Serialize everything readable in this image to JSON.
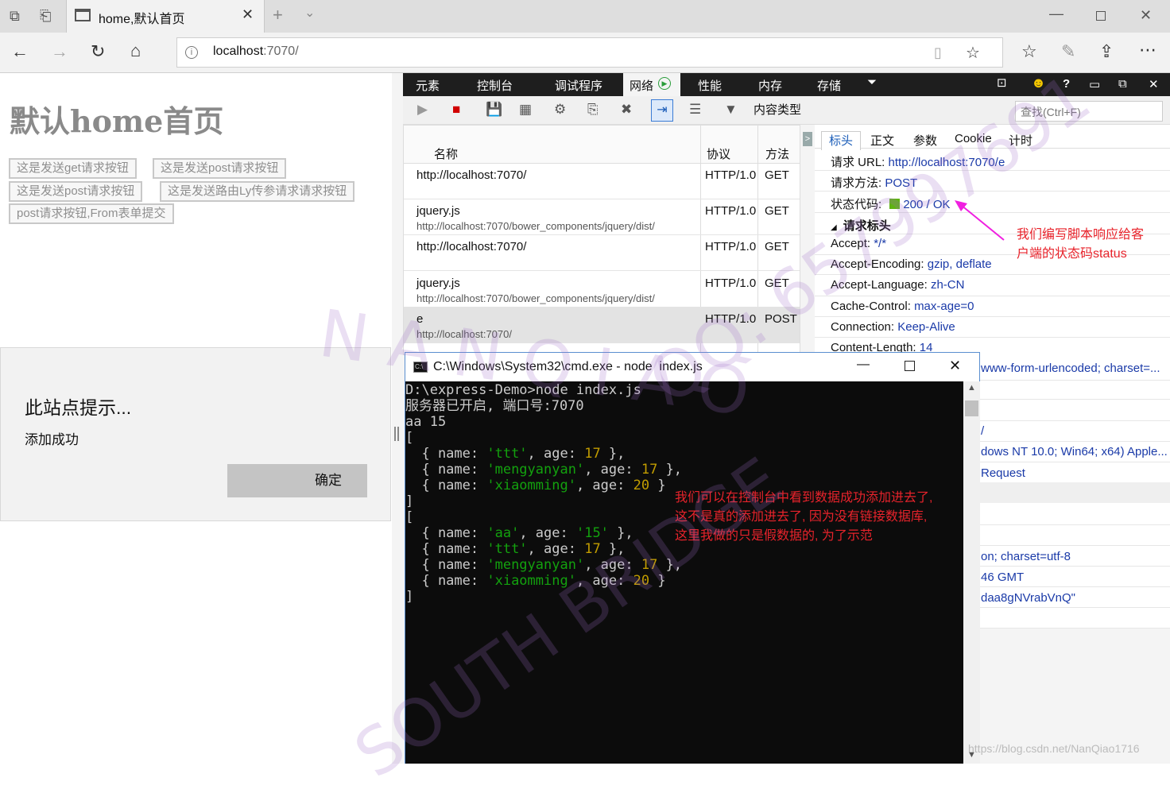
{
  "browser": {
    "tab_title": "home,默认首页",
    "url_host": "localhost",
    "url_rest": ":7070/"
  },
  "page": {
    "heading": "默认home首页",
    "buttons": [
      "这是发送get请求按钮",
      "这是发送post请求按钮",
      "这是发送post请求按钮",
      "这是发送路由Ly传参请求请求按钮",
      "post请求按钮,From表单提交"
    ]
  },
  "dialog": {
    "title": "此站点提示...",
    "message": "添加成功",
    "ok_label": "确定"
  },
  "devtools": {
    "menu": [
      "元素",
      "控制台",
      "调试程序",
      "网络",
      "性能",
      "内存",
      "存储"
    ],
    "content_type_label": "内容类型",
    "search_placeholder": "查找(Ctrl+F)",
    "columns": {
      "name": "名称",
      "protocol": "协议",
      "method": "方法"
    },
    "requests": [
      {
        "name": "http://localhost:7070/",
        "path": "",
        "protocol": "HTTP/1.0",
        "method": "GET"
      },
      {
        "name": "jquery.js",
        "path": "http://localhost:7070/bower_components/jquery/dist/",
        "protocol": "HTTP/1.0",
        "method": "GET"
      },
      {
        "name": "http://localhost:7070/",
        "path": "",
        "protocol": "HTTP/1.0",
        "method": "GET"
      },
      {
        "name": "jquery.js",
        "path": "http://localhost:7070/bower_components/jquery/dist/",
        "protocol": "HTTP/1.0",
        "method": "GET"
      },
      {
        "name": "e",
        "path": "http://localhost:7070/",
        "protocol": "HTTP/1.0",
        "method": "POST"
      }
    ],
    "detail_tabs": [
      "标头",
      "正文",
      "参数",
      "Cookie",
      "计时"
    ],
    "request_url_label": "请求 URL:",
    "request_url": "http://localhost:7070/e",
    "request_method_label": "请求方法:",
    "request_method": "POST",
    "status_label": "状态代码:",
    "status_value": "200 / OK",
    "status_color": "#5fb313",
    "request_headers_label": "请求标头",
    "headers": [
      {
        "k": "Accept:",
        "v": "*/*"
      },
      {
        "k": "Accept-Encoding:",
        "v": "gzip, deflate"
      },
      {
        "k": "Accept-Language:",
        "v": "zh-CN"
      },
      {
        "k": "Cache-Control:",
        "v": "max-age=0"
      },
      {
        "k": "Connection:",
        "v": "Keep-Alive"
      },
      {
        "k": "Content-Length:",
        "v": "14"
      }
    ],
    "partial_lines": [
      "www-form-urlencoded; charset=...",
      "/",
      "dows NT 10.0; Win64; x64) Apple...",
      "Request",
      "on; charset=utf-8",
      "46 GMT",
      "daa8gNVrabVnQ\""
    ]
  },
  "cmd": {
    "title": "C:\\Windows\\System32\\cmd.exe - node  index.js",
    "prompt": "D:\\express-Demo>node index.js",
    "server_line": "服务器已开启, 端口号:7070",
    "aa_line": "aa 15",
    "array1": [
      {
        "name": "'ttt'",
        "age": "17"
      },
      {
        "name": "'mengyanyan'",
        "age": "17"
      },
      {
        "name": "'xiaomming'",
        "age": "20"
      }
    ],
    "array2": [
      {
        "name": "'aa'",
        "age": "'15'"
      },
      {
        "name": "'ttt'",
        "age": "17"
      },
      {
        "name": "'mengyanyan'",
        "age": "17"
      },
      {
        "name": "'xiaomming'",
        "age": "20"
      }
    ]
  },
  "annotations": {
    "status_note": [
      "我们编写脚本响应给客",
      "户端的状态码status"
    ],
    "console_note": [
      "我们可以在控制台中看到数据成功添加进去了,",
      "这不是真的添加进去了, 因为没有链接数据库,",
      "这里我做的只是假数据的, 为了示范"
    ]
  },
  "watermark": {
    "line1": "N A N   Q I A O",
    "line2": "QQ: 657997691",
    "line3": "SOUTH BRIDGE",
    "credit": "https://blog.csdn.net/NanQiao1716"
  }
}
